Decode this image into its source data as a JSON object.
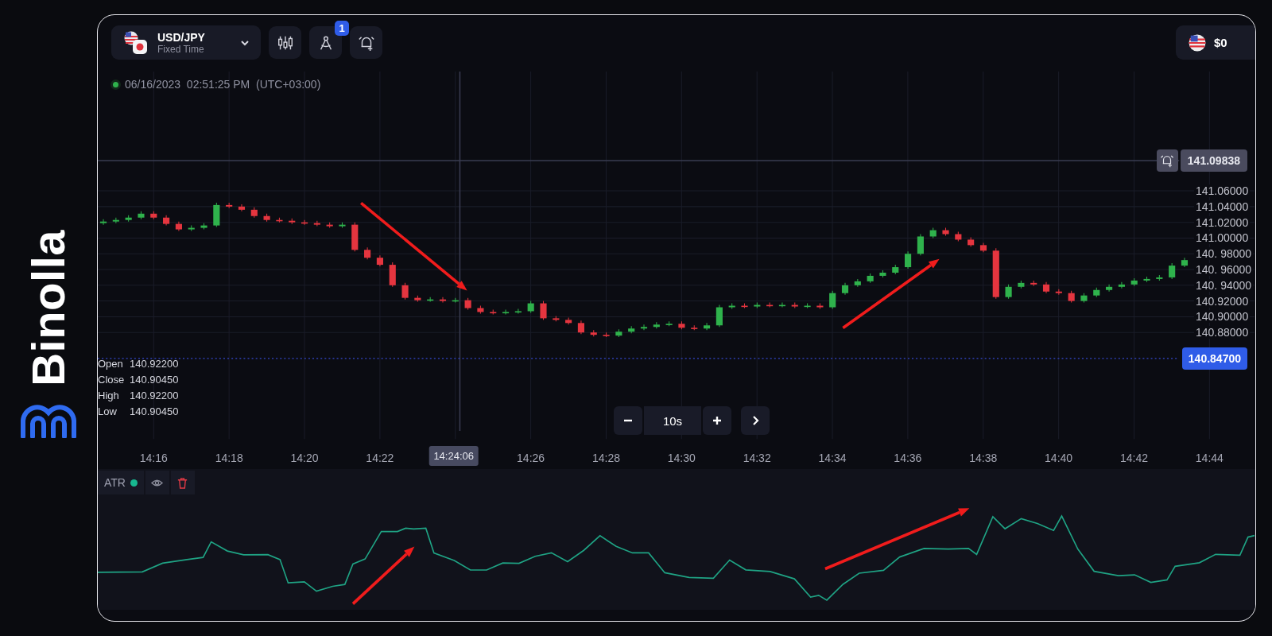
{
  "logo": {
    "text": "Binolla"
  },
  "top_bar": {
    "symbol": "USD/JPY",
    "symbol_type": "Fixed Time",
    "tools_badge": "1",
    "balance": "$0"
  },
  "chart": {
    "timestamp": "06/16/2023  02:51:25 PM  (UTC+03:00)",
    "ohlc": [
      {
        "label": "Open",
        "value": "140.92200"
      },
      {
        "label": "Close",
        "value": "140.90450"
      },
      {
        "label": "High",
        "value": "140.92200"
      },
      {
        "label": "Low",
        "value": "140.90450"
      }
    ],
    "interval": "10s",
    "time_ticks": [
      {
        "label": "14:16",
        "kind": "tick"
      },
      {
        "label": "14:18",
        "kind": "tick"
      },
      {
        "label": "14:20",
        "kind": "tick"
      },
      {
        "label": "14:22",
        "kind": "tick"
      },
      {
        "label": "14:24:06",
        "kind": "cursor"
      },
      {
        "label": "14:26",
        "kind": "tick"
      },
      {
        "label": "14:28",
        "kind": "tick"
      },
      {
        "label": "14:30",
        "kind": "tick"
      },
      {
        "label": "14:32",
        "kind": "tick"
      },
      {
        "label": "14:34",
        "kind": "tick"
      },
      {
        "label": "14:36",
        "kind": "tick"
      },
      {
        "label": "14:38",
        "kind": "tick"
      },
      {
        "label": "14:40",
        "kind": "tick"
      },
      {
        "label": "14:42",
        "kind": "tick"
      },
      {
        "label": "14:44",
        "kind": "tick"
      }
    ],
    "chart_data": {
      "type": "candlestick",
      "grid": true,
      "ylim": [
        140.847,
        141.09838
      ],
      "ref_lines": [
        {
          "axis": "y",
          "value": 141.09838,
          "label": "141.09838",
          "color": "#3a3c52"
        },
        {
          "axis": "y",
          "value": 140.847,
          "label": "140.84700",
          "color": "#3447c9"
        }
      ],
      "yticks": [
        {
          "value": 141.06,
          "label": "141.06000"
        },
        {
          "value": 141.04,
          "label": "141.04000"
        },
        {
          "value": 141.02,
          "label": "141.02000"
        },
        {
          "value": 141.0,
          "label": "141.00000"
        },
        {
          "value": 140.98,
          "label": "140. 98000"
        },
        {
          "value": 140.96,
          "label": "140. 96000"
        },
        {
          "value": 140.94,
          "label": "140. 94000"
        },
        {
          "value": 140.92,
          "label": "140.92000"
        },
        {
          "value": 140.9,
          "label": "140.90000"
        },
        {
          "value": 140.88,
          "label": "140.88000"
        }
      ],
      "categories": [
        null,
        null,
        null,
        null,
        null,
        null,
        null,
        null,
        null,
        null,
        null,
        null,
        null,
        null,
        null,
        null,
        null,
        null,
        null,
        null,
        null,
        null,
        null,
        null,
        null,
        null,
        null,
        null,
        null,
        null,
        null,
        null,
        null,
        null,
        null,
        null,
        null,
        null,
        null,
        null,
        null,
        null,
        null,
        null,
        null,
        null,
        null,
        null,
        null,
        null,
        null,
        null,
        null,
        null,
        null,
        null,
        null,
        null,
        null,
        null,
        null,
        null,
        null,
        null,
        null,
        null,
        null,
        null,
        null,
        null,
        null,
        null,
        null,
        null,
        null,
        null,
        null,
        null,
        null,
        null,
        null,
        null,
        null,
        null,
        null,
        null,
        null
      ],
      "ohlc": [
        [
          141.019,
          141.024,
          141.017,
          141.021
        ],
        [
          141.021,
          141.026,
          141.019,
          141.023
        ],
        [
          141.023,
          141.029,
          141.021,
          141.026
        ],
        [
          141.026,
          141.034,
          141.024,
          141.031
        ],
        [
          141.031,
          141.034,
          141.024,
          141.026
        ],
        [
          141.026,
          141.029,
          141.016,
          141.018
        ],
        [
          141.018,
          141.021,
          141.009,
          141.011
        ],
        [
          141.011,
          141.016,
          141.009,
          141.013
        ],
        [
          141.013,
          141.019,
          141.011,
          141.016
        ],
        [
          141.016,
          141.045,
          141.014,
          141.042
        ],
        [
          141.042,
          141.045,
          141.038,
          141.04
        ],
        [
          141.04,
          141.043,
          141.034,
          141.036
        ],
        [
          141.036,
          141.039,
          141.026,
          141.028
        ],
        [
          141.028,
          141.031,
          141.021,
          141.023
        ],
        [
          141.023,
          141.026,
          141.02,
          141.022
        ],
        [
          141.022,
          141.025,
          141.018,
          141.02
        ],
        [
          141.02,
          141.023,
          141.017,
          141.019
        ],
        [
          141.019,
          141.022,
          141.015,
          141.017
        ],
        [
          141.017,
          141.02,
          141.013,
          141.015
        ],
        [
          141.015,
          141.02,
          141.013,
          141.017
        ],
        [
          141.017,
          141.02,
          140.983,
          140.985
        ],
        [
          140.985,
          140.988,
          140.973,
          140.975
        ],
        [
          140.975,
          140.978,
          140.964,
          140.966
        ],
        [
          140.966,
          140.969,
          140.938,
          140.94
        ],
        [
          140.94,
          140.943,
          140.922,
          140.924
        ],
        [
          140.924,
          140.927,
          140.919,
          140.921
        ],
        [
          140.921,
          140.925,
          140.919,
          140.922
        ],
        [
          140.922,
          140.925,
          140.918,
          140.92
        ],
        [
          140.92,
          140.924,
          140.918,
          140.921
        ],
        [
          140.921,
          140.924,
          140.909,
          140.911
        ],
        [
          140.911,
          140.914,
          140.904,
          140.906
        ],
        [
          140.906,
          140.909,
          140.903,
          140.905
        ],
        [
          140.905,
          140.909,
          140.903,
          140.906
        ],
        [
          140.906,
          140.91,
          140.904,
          140.907
        ],
        [
          140.907,
          140.92,
          140.905,
          140.917
        ],
        [
          140.917,
          140.92,
          140.896,
          140.898
        ],
        [
          140.898,
          140.901,
          140.894,
          140.896
        ],
        [
          140.896,
          140.899,
          140.89,
          140.892
        ],
        [
          140.892,
          140.895,
          140.878,
          140.88
        ],
        [
          140.88,
          140.883,
          140.875,
          140.877
        ],
        [
          140.877,
          140.88,
          140.874,
          140.876
        ],
        [
          140.876,
          140.884,
          140.874,
          140.881
        ],
        [
          140.881,
          140.888,
          140.879,
          140.885
        ],
        [
          140.885,
          140.89,
          140.883,
          140.887
        ],
        [
          140.887,
          140.893,
          140.885,
          140.89
        ],
        [
          140.89,
          140.894,
          140.888,
          140.891
        ],
        [
          140.891,
          140.894,
          140.884,
          140.886
        ],
        [
          140.886,
          140.889,
          140.883,
          140.885
        ],
        [
          140.885,
          140.892,
          140.883,
          140.889
        ],
        [
          140.889,
          140.915,
          140.887,
          140.912
        ],
        [
          140.912,
          140.917,
          140.91,
          140.914
        ],
        [
          140.914,
          140.917,
          140.911,
          140.913
        ],
        [
          140.913,
          140.918,
          140.911,
          140.915
        ],
        [
          140.915,
          140.918,
          140.912,
          140.914
        ],
        [
          140.914,
          140.918,
          140.912,
          140.915
        ],
        [
          140.915,
          140.918,
          140.911,
          140.913
        ],
        [
          140.913,
          140.917,
          140.911,
          140.914
        ],
        [
          140.914,
          140.917,
          140.91,
          140.912
        ],
        [
          140.912,
          140.933,
          140.91,
          140.93
        ],
        [
          140.93,
          140.943,
          140.928,
          140.94
        ],
        [
          140.94,
          140.948,
          140.938,
          140.945
        ],
        [
          140.945,
          140.955,
          140.943,
          140.952
        ],
        [
          140.952,
          140.959,
          140.95,
          140.956
        ],
        [
          140.956,
          140.966,
          140.954,
          140.963
        ],
        [
          140.963,
          140.983,
          140.961,
          140.98
        ],
        [
          140.98,
          141.005,
          140.978,
          141.002
        ],
        [
          141.002,
          141.013,
          141.0,
          141.01
        ],
        [
          141.01,
          141.013,
          141.003,
          141.005
        ],
        [
          141.005,
          141.008,
          140.996,
          140.998
        ],
        [
          140.998,
          141.001,
          140.989,
          140.991
        ],
        [
          140.991,
          140.994,
          140.982,
          140.984
        ],
        [
          140.984,
          140.987,
          140.923,
          140.925
        ],
        [
          140.925,
          140.941,
          140.923,
          140.938
        ],
        [
          140.938,
          140.946,
          140.936,
          140.943
        ],
        [
          140.943,
          140.946,
          140.939,
          140.941
        ],
        [
          140.941,
          140.944,
          140.93,
          140.932
        ],
        [
          140.932,
          140.935,
          140.928,
          140.93
        ],
        [
          140.93,
          140.933,
          140.918,
          140.92
        ],
        [
          140.92,
          140.93,
          140.918,
          140.927
        ],
        [
          140.927,
          140.937,
          140.925,
          140.934
        ],
        [
          140.934,
          140.941,
          140.932,
          140.938
        ],
        [
          140.938,
          140.944,
          140.936,
          140.941
        ],
        [
          140.941,
          140.949,
          140.939,
          140.946
        ],
        [
          140.946,
          140.951,
          140.944,
          140.948
        ],
        [
          140.948,
          140.953,
          140.946,
          140.95
        ],
        [
          140.95,
          140.968,
          140.948,
          140.965
        ],
        [
          140.965,
          140.975,
          140.963,
          140.972
        ]
      ]
    }
  },
  "indicator": {
    "name": "ATR"
  }
}
